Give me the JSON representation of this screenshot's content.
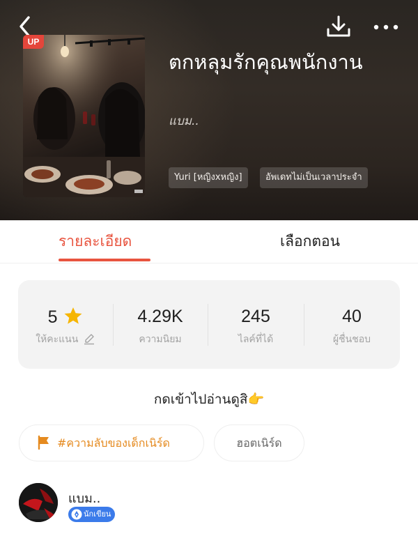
{
  "header": {
    "cover_badge": "UP",
    "title": "ตกหลุมรักคุณพนักงาน",
    "author": "แบม..",
    "tags": [
      "Yuri [หญิงxหญิง]",
      "อัพเดทไม่เป็นเวลาประจำ"
    ]
  },
  "tabs": {
    "detail": "รายละเอียด",
    "episodes": "เลือกตอน",
    "active": "detail"
  },
  "stats": [
    {
      "value": "5",
      "label": "ให้คะแนน"
    },
    {
      "value": "4.29K",
      "label": "ความนิยม"
    },
    {
      "value": "245",
      "label": "ไลค์ที่ได้"
    },
    {
      "value": "40",
      "label": "ผู้ชื่นชอบ"
    }
  ],
  "tagline": "กดเข้าไปอ่านดูสิ👉",
  "chips": {
    "hashtag": "#ความลับของเด็กเนิร์ด",
    "hot": "ฮอตเนิร์ด"
  },
  "author_card": {
    "name": "แบม..",
    "badge": "นักเขียน"
  },
  "colors": {
    "accent": "#e8543f",
    "hashtag": "#e58a1f",
    "badge_blue": "#3b7bea",
    "up_badge": "#e4463b",
    "star": "#f6b500"
  }
}
